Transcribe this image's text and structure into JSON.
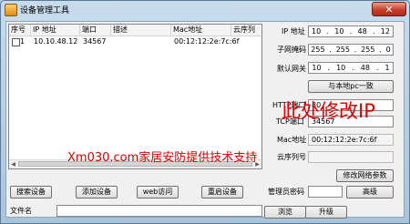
{
  "window": {
    "title": "设备管理工具",
    "close_glyph": "✕"
  },
  "table": {
    "columns": [
      "序号",
      "IP 地址",
      "端口",
      "描述",
      "Mac地址",
      "云序列"
    ],
    "rows": [
      {
        "index": "1",
        "ip": "10.10.48.12",
        "port": "34567",
        "desc": "",
        "mac": "00:12:12:2e:7c:6f",
        "serial": ""
      }
    ]
  },
  "buttons": {
    "search": "搜索设备",
    "add": "添加设备",
    "web": "web访问",
    "restart": "重启设备",
    "match_local": "与本地pc一致",
    "modify_network": "修改网络参数",
    "advanced": "高级",
    "browse": "浏览",
    "upgrade": "升级"
  },
  "form": {
    "ip_label": "IP 地址",
    "ip": [
      "10",
      "10",
      "48",
      "12"
    ],
    "mask_label": "子网掩码",
    "mask": [
      "255",
      "255",
      "255",
      "0"
    ],
    "gateway_label": "默认网关",
    "gateway": [
      "10",
      "10",
      "48",
      "1"
    ],
    "http_label": "HTTP端口",
    "http_port": "80",
    "tcp_label": "TCP端口",
    "tcp_port": "34567",
    "mac_label": "Mac地址",
    "mac": "00:12:12:2e:7c:6f",
    "serial_label": "云序列号",
    "serial": "",
    "admin_pwd_label": "管理员密码",
    "admin_pwd": "",
    "file_label": "文件名",
    "file": ""
  },
  "overlays": {
    "modify_ip": "此处修改IP",
    "watermark": "Xm030.com家居安防提供技术支持"
  },
  "colors": {
    "overlay_red": "#e00000",
    "close_button": "#c8402b"
  }
}
